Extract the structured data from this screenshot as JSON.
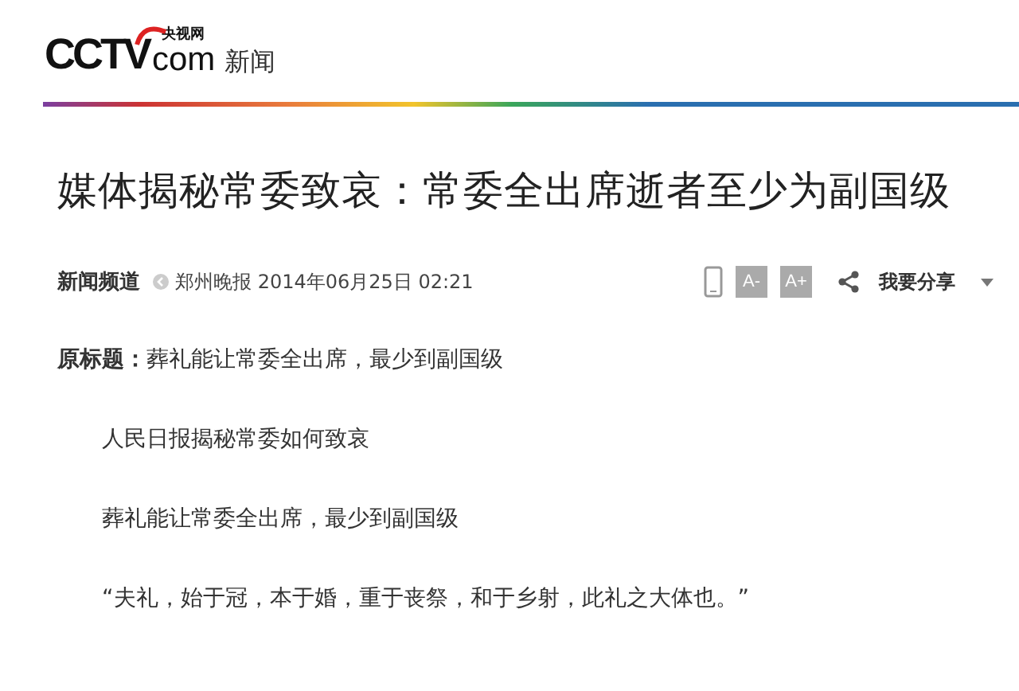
{
  "header": {
    "logo_main": "CCTV",
    "logo_small": "央视网",
    "logo_domain": "com",
    "section": "新闻"
  },
  "article": {
    "title": "媒体揭秘常委致哀：常委全出席逝者至少为副国级",
    "channel": "新闻频道",
    "source": "郑州晚报 2014年06月25日 02:21",
    "tools": [
      {
        "kind": "mobile"
      },
      {
        "kind": "text",
        "label": "A-"
      },
      {
        "kind": "text",
        "label": "A+"
      }
    ],
    "share": "我要分享",
    "paragraphs": [
      {
        "kind": "lead",
        "label": "原标题：",
        "text": "葬礼能让常委全出席，最少到副国级"
      },
      {
        "kind": "body",
        "text": "人民日报揭秘常委如何致哀"
      },
      {
        "kind": "body",
        "text": "葬礼能让常委全出席，最少到副国级"
      },
      {
        "kind": "body",
        "text": "“夫礼，始于冠，本于婚，重于丧祭，和于乡射，此礼之大体也。”"
      }
    ]
  }
}
